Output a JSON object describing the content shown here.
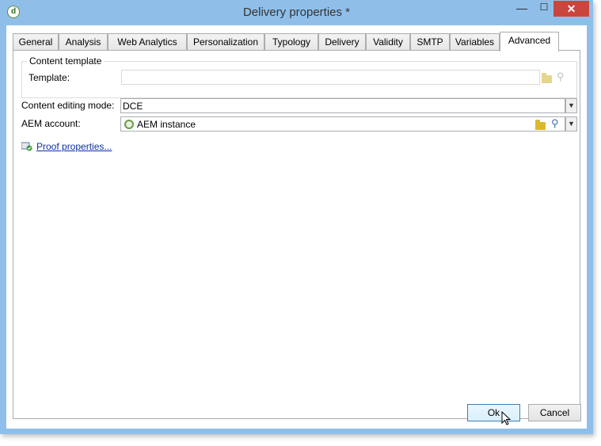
{
  "window": {
    "title": "Delivery properties *",
    "app_icon_glyph": "d",
    "controls": {
      "minimize": "—",
      "maximize": "☐",
      "close": "✕"
    }
  },
  "tabs": [
    {
      "label": "General",
      "active": false
    },
    {
      "label": "Analysis",
      "active": false
    },
    {
      "label": "Web Analytics",
      "active": false
    },
    {
      "label": "Personalization",
      "active": false
    },
    {
      "label": "Typology",
      "active": false
    },
    {
      "label": "Delivery",
      "active": false
    },
    {
      "label": "Validity",
      "active": false
    },
    {
      "label": "SMTP",
      "active": false
    },
    {
      "label": "Variables",
      "active": false
    },
    {
      "label": "Advanced",
      "active": true
    }
  ],
  "content_template": {
    "group_title": "Content template",
    "template_label": "Template:",
    "template_value": ""
  },
  "content_editing_mode": {
    "label": "Content editing mode:",
    "value": "DCE"
  },
  "aem_account": {
    "label": "AEM account:",
    "value": "AEM instance"
  },
  "proof_link": "Proof properties...",
  "buttons": {
    "ok": "Ok",
    "cancel": "Cancel"
  },
  "colors": {
    "frame": "#8fbfe9",
    "close_button": "#c9463d",
    "link": "#0b2ea8",
    "folder": "#d9b92c"
  }
}
